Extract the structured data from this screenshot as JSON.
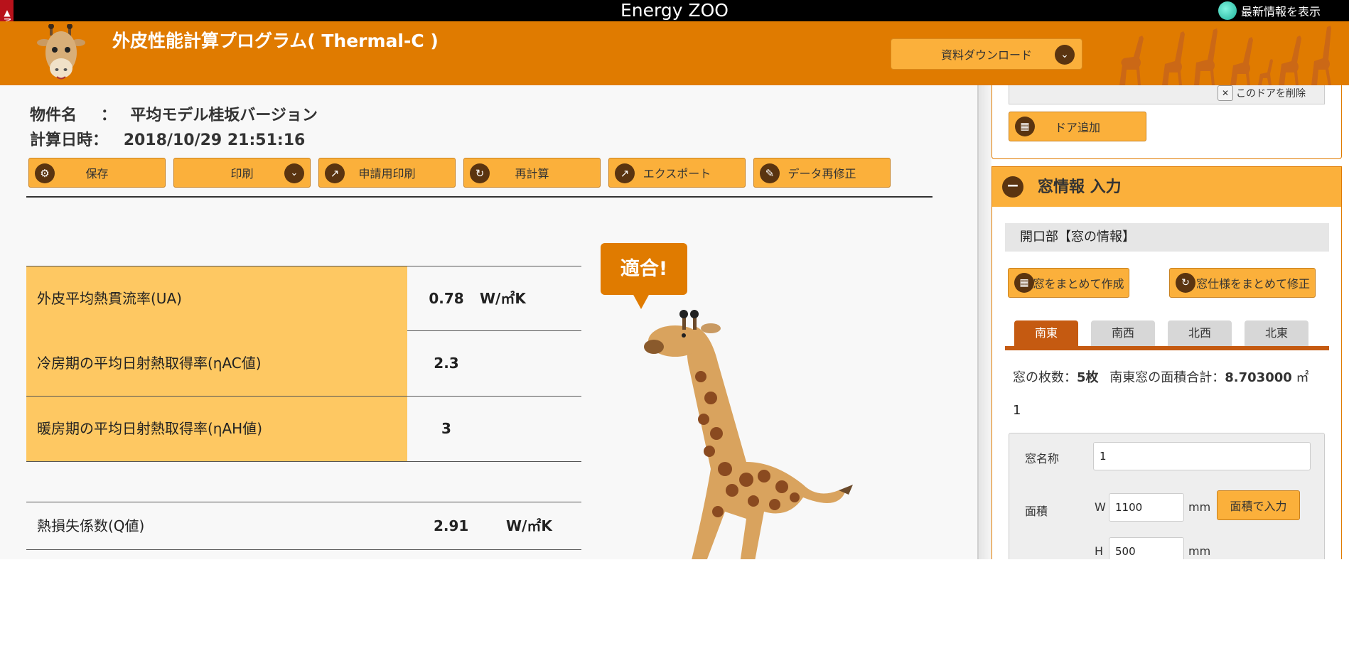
{
  "app": {
    "site_title": "Energy ZOO",
    "menu_tab": "▲Menu",
    "news_label": "最新情報を表示",
    "program_title": "外皮性能計算プログラム( Thermal-C )",
    "download_label": "資料ダウンロード"
  },
  "project": {
    "name_label": "物件名",
    "name_sep": "：",
    "name_value": "平均モデル桂坂バージョン",
    "date_label": "計算日時：",
    "date_value": "2018/10/29 21:51:16"
  },
  "toolbar": {
    "save": "保存",
    "print": "印刷",
    "apply_print": "申請用印刷",
    "recalc": "再計算",
    "export": "エクスポート",
    "data_edit": "データ再修正"
  },
  "results": [
    {
      "label": "外皮平均熱貫流率(UA)",
      "value": "0.78",
      "unit": "W/㎡K"
    },
    {
      "label": "冷房期の平均日射熱取得率(ηAC値)",
      "value": "2.3",
      "unit": ""
    },
    {
      "label": "暖房期の平均日射熱取得率(ηAH値)",
      "value": "3",
      "unit": ""
    }
  ],
  "q_value": {
    "label": "熱損失係数(Q値)",
    "value": "2.91",
    "unit": "W/㎡K"
  },
  "verdict": "適合!",
  "side": {
    "door_delete": "このドアを削除",
    "door_add": "ドア追加",
    "window_header": "窓情報 入力",
    "opening_title": "開口部【窓の情報】",
    "batch_create": "窓をまとめて作成",
    "batch_edit": "窓仕様をまとめて修正",
    "tabs": [
      "南東",
      "南西",
      "北西",
      "北東"
    ],
    "summary_prefix": "窓の枚数：",
    "count": "5枚",
    "area_prefix": "南東窓の面積合計：",
    "area_total": "8.703000",
    "area_unit": "㎡",
    "window_index": "1",
    "form": {
      "name_label": "窓名称",
      "name_value": "1",
      "area_label": "面積",
      "w_label": "W",
      "w_value": "1100",
      "h_label": "H",
      "h_value": "500",
      "mm": "mm",
      "area_input_btn": "面積で入力"
    }
  }
}
